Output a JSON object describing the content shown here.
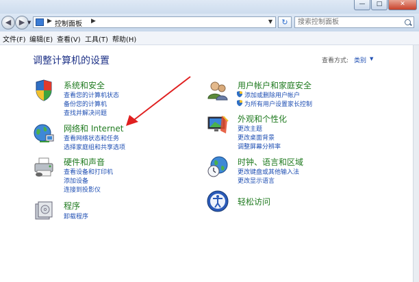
{
  "window": {
    "minimize_glyph": "—",
    "maximize_glyph": "□",
    "close_glyph": "✕"
  },
  "address": {
    "crumb": "控制面板",
    "separator": "▶"
  },
  "search": {
    "placeholder": "搜索控制面板"
  },
  "menu": [
    "文件(F)",
    "编辑(E)",
    "查看(V)",
    "工具(T)",
    "帮助(H)"
  ],
  "page": {
    "heading": "调整计算机的设置",
    "view_by_label": "查看方式:",
    "view_by_value": "类别"
  },
  "categories": {
    "system": {
      "title": "系统和安全",
      "links": [
        "查看您的计算机状态",
        "备份您的计算机",
        "查找并解决问题"
      ]
    },
    "network": {
      "title": "网络和 Internet",
      "links": [
        "查看网络状态和任务",
        "选择家庭组和共享选项"
      ]
    },
    "hardware": {
      "title": "硬件和声音",
      "links": [
        "查看设备和打印机",
        "添加设备",
        "连接到投影仪"
      ]
    },
    "programs": {
      "title": "程序",
      "links": [
        "卸载程序"
      ]
    },
    "users": {
      "title": "用户帐户和家庭安全",
      "links": [
        "添加或删除用户帐户",
        "为所有用户设置家长控制"
      ]
    },
    "appearance": {
      "title": "外观和个性化",
      "links": [
        "更改主题",
        "更改桌面背景",
        "调整屏幕分辨率"
      ]
    },
    "clock": {
      "title": "时钟、语言和区域",
      "links": [
        "更改键盘或其他输入法",
        "更改显示语言"
      ]
    },
    "ease": {
      "title": "轻松访问",
      "links": []
    }
  },
  "colors": {
    "heading": "#1e3287",
    "category_title": "#1f7a1f",
    "link": "#1f4fb3",
    "annotation_arrow": "#e02020"
  }
}
